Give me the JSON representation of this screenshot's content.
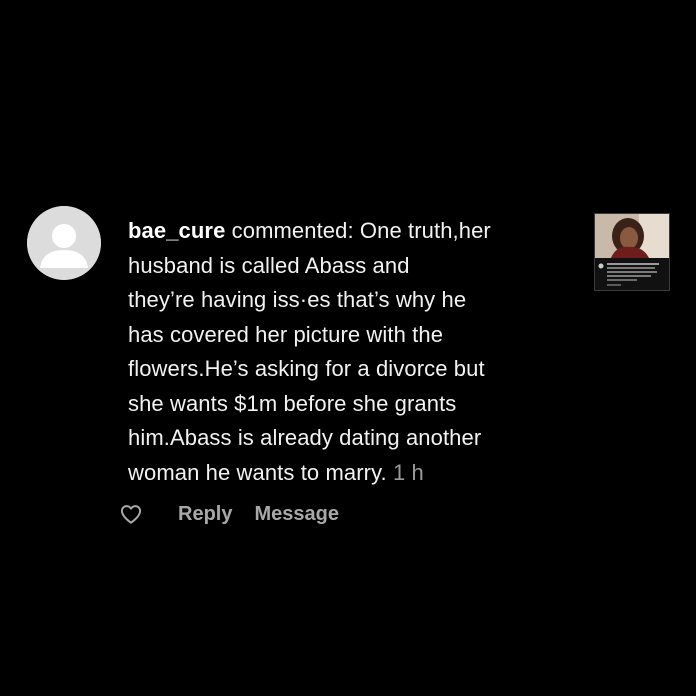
{
  "comment": {
    "username": "bae_cure",
    "action_text": "commented:",
    "lines": [
      "One truth,her",
      "husband is called Abass and",
      "they’re having iss·es that’s why he",
      "has covered her picture with the",
      "flowers.He’s asking for a divorce but",
      "she wants $1m before she grants",
      "him.Abass is already dating another",
      "woman he wants to marry."
    ],
    "timestamp": "1 h"
  },
  "actions": {
    "like_icon": "heart-outline-icon",
    "reply_label": "Reply",
    "message_label": "Message"
  },
  "avatar": {
    "icon": "default-profile-icon"
  },
  "thumbnail": {
    "icon": "post-thumbnail"
  },
  "colors": {
    "background": "#000000",
    "text": "#f2f2f2",
    "muted": "#a8a8a8",
    "avatar": "#dcdcdc"
  }
}
